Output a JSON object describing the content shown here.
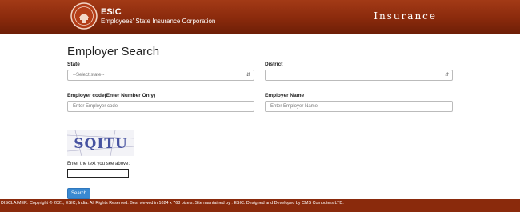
{
  "header": {
    "brand_name": "ESIC",
    "brand_subtitle": "Employees' State Insurance Corporation",
    "right_title": "Insurance",
    "logo_icon": "esic-emblem-logo"
  },
  "form": {
    "title": "Employer Search",
    "state": {
      "label": "State",
      "selected": "--Select state--"
    },
    "district": {
      "label": "District",
      "selected": ""
    },
    "employer_code": {
      "label": "Employer code(Enter Number Only)",
      "placeholder": "Enter Employer code"
    },
    "employer_name": {
      "label": "Employer Name",
      "placeholder": "Enter Employer Name"
    },
    "captcha": {
      "text": "SQITU",
      "prompt": "Enter the text you see above:"
    },
    "search_label": "Search"
  },
  "footer": {
    "text": "DISCLAIMER: Copyright © 2021, ESIC, India. All Rights Reserved. Best viewed in 1024 x 768 pixels. Site maintained by : ESIC. Designed and Developed by CMS Computers LTD."
  },
  "colors": {
    "header": "#8a2a0c",
    "button": "#3a89d1"
  }
}
